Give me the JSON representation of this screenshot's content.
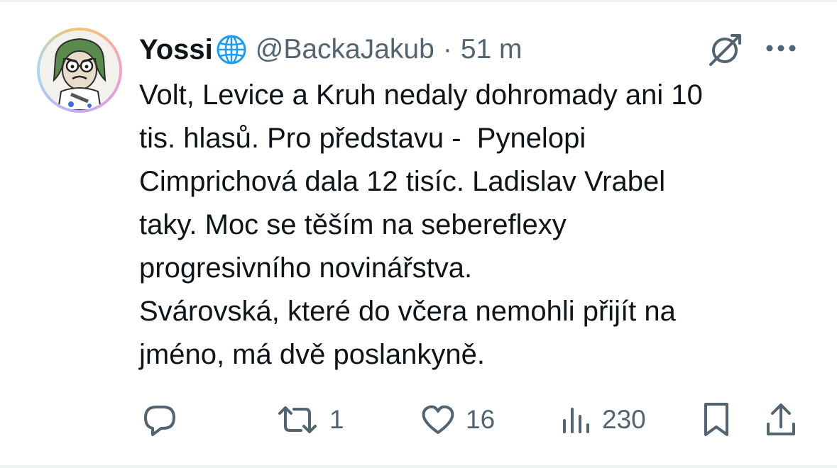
{
  "post": {
    "display_name": "Yossi",
    "handle": "@BackaJakub",
    "separator": "·",
    "time": "51 m",
    "text": "Volt, Levice a Kruh nedaly dohromady ani 10\ntis. hlasů. Pro představu -  Pynelopi\nCimprichová dala 12 tisíc. Ladislav Vrabel\ntaky. Moc se těším na sebereflexy\nprogresivního novinářstva.\nSvárovská, které do včera nemohli přijít na\njméno, má dvě poslankyně."
  },
  "icons": {
    "verified": "globe-icon",
    "grok": "grok-icon",
    "more": "more-icon",
    "reply": "reply-icon",
    "repost": "repost-icon",
    "like": "like-icon",
    "views": "views-icon",
    "bookmark": "bookmark-icon",
    "share": "share-icon"
  },
  "actions": {
    "reply_count": "",
    "repost_count": "1",
    "like_count": "16",
    "view_count": "230"
  },
  "colors": {
    "text": "#0f1419",
    "secondary": "#536471",
    "globe": "#1d9bf0",
    "divider": "#eff3f4"
  }
}
